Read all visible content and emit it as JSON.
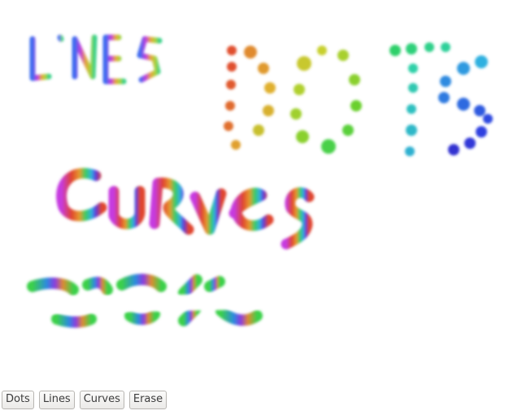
{
  "drawing": {
    "words": [
      {
        "id": "lines",
        "text": "LiNES"
      },
      {
        "id": "dots",
        "text": "DOTS"
      },
      {
        "id": "curves",
        "text": "CuRves"
      },
      {
        "id": "erase",
        "text": "erase"
      }
    ]
  },
  "toolbar": {
    "buttons": [
      {
        "id": "dots",
        "label": "Dots"
      },
      {
        "id": "lines",
        "label": "Lines"
      },
      {
        "id": "curves",
        "label": "Curves"
      },
      {
        "id": "erase",
        "label": "Erase"
      }
    ]
  }
}
